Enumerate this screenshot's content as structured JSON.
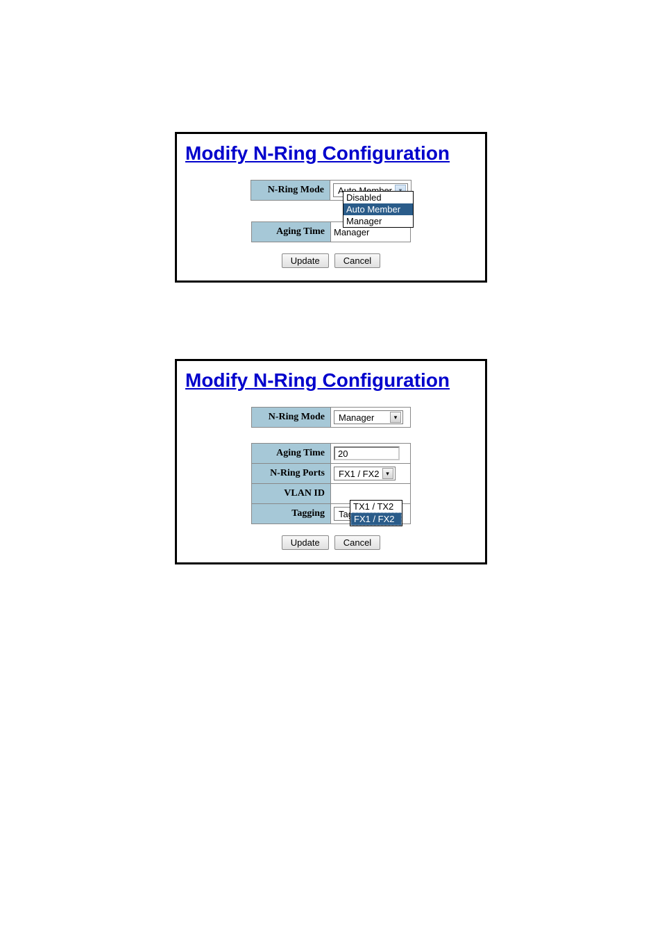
{
  "panel1": {
    "title": "Modify N-Ring Configuration",
    "rows": {
      "mode_label": "N-Ring Mode",
      "mode_value": "Auto Member",
      "aging_label": "Aging Time",
      "aging_value": "Manager"
    },
    "dropdown_options": {
      "opt1": "Disabled",
      "opt2": "Auto Member",
      "opt3": "Manager"
    },
    "buttons": {
      "update": "Update",
      "cancel": "Cancel"
    }
  },
  "panel2": {
    "title": "Modify N-Ring Configuration",
    "rows": {
      "mode_label": "N-Ring Mode",
      "mode_value": "Manager",
      "aging_label": "Aging Time",
      "aging_value": "20",
      "ports_label": "N-Ring Ports",
      "ports_value": "FX1 / FX2",
      "vlan_label": "VLAN ID",
      "tagging_label": "Tagging",
      "tagging_value": "Tagged"
    },
    "ports_dropdown": {
      "opt1": "TX1 / TX2",
      "opt2": "FX1 / FX2"
    },
    "buttons": {
      "update": "Update",
      "cancel": "Cancel"
    }
  }
}
